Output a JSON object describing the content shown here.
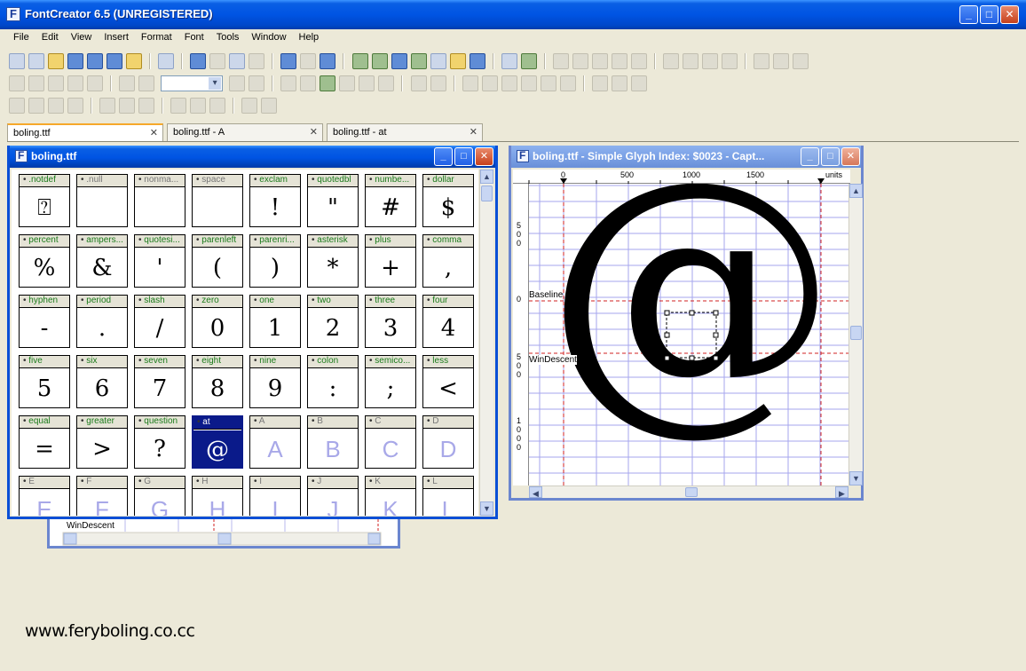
{
  "window": {
    "title": "FontCreator 6.5 (UNREGISTERED)"
  },
  "menu": [
    "File",
    "Edit",
    "View",
    "Insert",
    "Format",
    "Font",
    "Tools",
    "Window",
    "Help"
  ],
  "tabs": [
    {
      "label": "boling.ttf",
      "active": true
    },
    {
      "label": "boling.ttf - A",
      "active": false
    },
    {
      "label": "boling.ttf - at",
      "active": false
    }
  ],
  "glyph_window": {
    "title": "boling.ttf",
    "rows": [
      [
        {
          "name": ".notdef",
          "glyph": "⍰"
        },
        {
          "name": ".null",
          "glyph": ""
        },
        {
          "name": "nonma...",
          "glyph": ""
        },
        {
          "name": "space",
          "glyph": ""
        },
        {
          "name": "exclam",
          "glyph": "!"
        },
        {
          "name": "quotedbl",
          "glyph": "\""
        },
        {
          "name": "numbe...",
          "glyph": "#"
        },
        {
          "name": "dollar",
          "glyph": "$"
        }
      ],
      [
        {
          "name": "percent",
          "glyph": "%"
        },
        {
          "name": "ampers...",
          "glyph": "&"
        },
        {
          "name": "quotesi...",
          "glyph": "'"
        },
        {
          "name": "parenleft",
          "glyph": "("
        },
        {
          "name": "parenri...",
          "glyph": ")"
        },
        {
          "name": "asterisk",
          "glyph": "*"
        },
        {
          "name": "plus",
          "glyph": "+"
        },
        {
          "name": "comma",
          "glyph": ","
        }
      ],
      [
        {
          "name": "hyphen",
          "glyph": "-"
        },
        {
          "name": "period",
          "glyph": "."
        },
        {
          "name": "slash",
          "glyph": "/"
        },
        {
          "name": "zero",
          "glyph": "0"
        },
        {
          "name": "one",
          "glyph": "1"
        },
        {
          "name": "two",
          "glyph": "2"
        },
        {
          "name": "three",
          "glyph": "3"
        },
        {
          "name": "four",
          "glyph": "4"
        }
      ],
      [
        {
          "name": "five",
          "glyph": "5"
        },
        {
          "name": "six",
          "glyph": "6"
        },
        {
          "name": "seven",
          "glyph": "7"
        },
        {
          "name": "eight",
          "glyph": "8"
        },
        {
          "name": "nine",
          "glyph": "9"
        },
        {
          "name": "colon",
          "glyph": ":"
        },
        {
          "name": "semico...",
          "glyph": ";"
        },
        {
          "name": "less",
          "glyph": "<"
        }
      ],
      [
        {
          "name": "equal",
          "glyph": "="
        },
        {
          "name": "greater",
          "glyph": ">"
        },
        {
          "name": "question",
          "glyph": "?"
        },
        {
          "name": "at",
          "glyph": "@",
          "selected": true
        },
        {
          "name": "A",
          "glyph": "A",
          "missing": true
        },
        {
          "name": "B",
          "glyph": "B",
          "missing": true
        },
        {
          "name": "C",
          "glyph": "C",
          "missing": true
        },
        {
          "name": "D",
          "glyph": "D",
          "missing": true
        }
      ],
      [
        {
          "name": "E",
          "glyph": "E",
          "missing": true
        },
        {
          "name": "F",
          "glyph": "F",
          "missing": true
        },
        {
          "name": "G",
          "glyph": "G",
          "missing": true
        },
        {
          "name": "H",
          "glyph": "H",
          "missing": true
        },
        {
          "name": "I",
          "glyph": "I",
          "missing": true
        },
        {
          "name": "J",
          "glyph": "J",
          "missing": true
        },
        {
          "name": "K",
          "glyph": "K",
          "missing": true
        },
        {
          "name": "L",
          "glyph": "L",
          "missing": true
        }
      ]
    ]
  },
  "hidden_window": {
    "label": "WinDescent"
  },
  "edit_window": {
    "title": "boling.ttf - Simple Glyph Index: $0023 - Capt...",
    "ruler_top": [
      "0",
      "500",
      "1000",
      "1500",
      "units"
    ],
    "ruler_left": [
      "5",
      "0",
      "0",
      "0",
      "5",
      "0",
      "0",
      "1",
      "0",
      "0",
      "0"
    ],
    "labels": {
      "baseline": "Baseline",
      "windescent": "WinDescent"
    },
    "glyph": "@"
  },
  "watermark": "www.feryboling.co.cc",
  "colors": {
    "title_blue": "#0054e3",
    "selected_cell": "#0a1a8a",
    "glyph_label_green": "#1a7a1a",
    "missing_glyph": "#a8a8e8",
    "grid_line": "#9a9ae6",
    "guide_red": "#d02020"
  }
}
